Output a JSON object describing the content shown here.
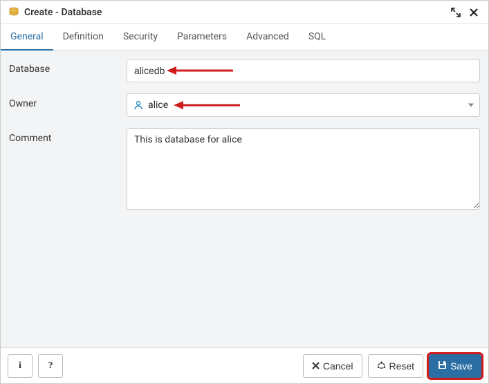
{
  "dialog": {
    "title": "Create - Database"
  },
  "tabs": {
    "items": [
      {
        "label": "General",
        "active": true
      },
      {
        "label": "Definition",
        "active": false
      },
      {
        "label": "Security",
        "active": false
      },
      {
        "label": "Parameters",
        "active": false
      },
      {
        "label": "Advanced",
        "active": false
      },
      {
        "label": "SQL",
        "active": false
      }
    ]
  },
  "form": {
    "database": {
      "label": "Database",
      "value": "alicedb"
    },
    "owner": {
      "label": "Owner",
      "value": "alice"
    },
    "comment": {
      "label": "Comment",
      "value": "This is database for alice"
    }
  },
  "footer": {
    "info": "i",
    "help": "?",
    "cancel": "Cancel",
    "reset": "Reset",
    "save": "Save"
  },
  "colors": {
    "accent": "#2b6ea3",
    "annotation": "#d11c1c"
  }
}
